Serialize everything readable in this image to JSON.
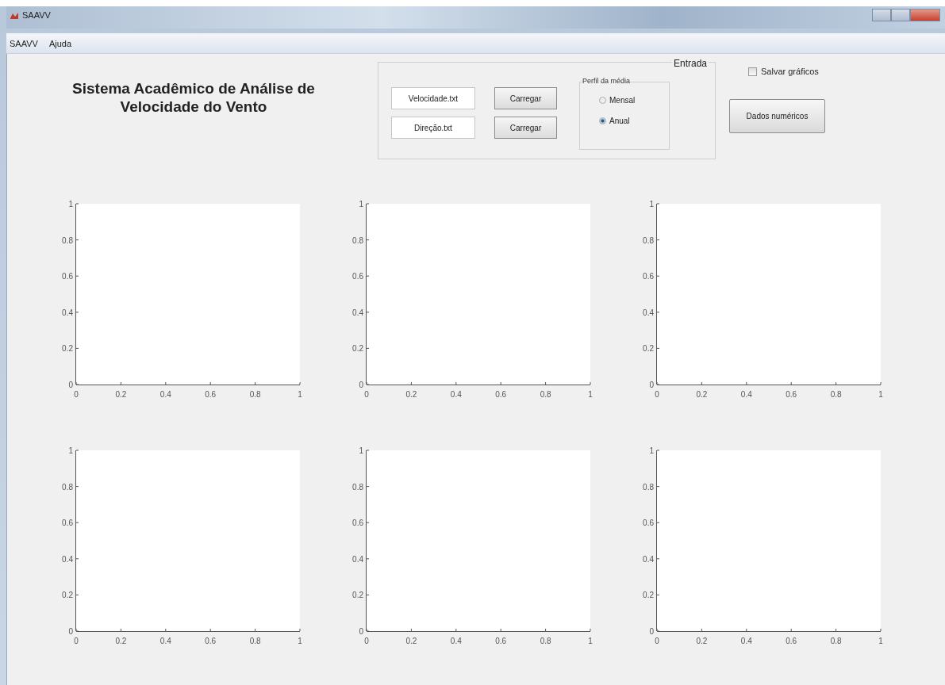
{
  "window": {
    "title": "SAAVV"
  },
  "menu": [
    {
      "label": "SAAVV"
    },
    {
      "label": "Ajuda"
    }
  ],
  "heading": "Sistema Acadêmico de Análise de Velocidade do Vento",
  "input_panel": {
    "title": "Entrada",
    "files": [
      {
        "value": "Velocidade.txt",
        "button": "Carregar"
      },
      {
        "value": "Direção.txt",
        "button": "Carregar"
      }
    ],
    "profile": {
      "title": "Perfil da média",
      "options": [
        {
          "label": "Mensal",
          "selected": false
        },
        {
          "label": "Anual",
          "selected": true
        }
      ]
    }
  },
  "save_charts": {
    "label": "Salvar gráficos",
    "checked": false
  },
  "numeric_button": "Dados numéricos",
  "plots": [
    {
      "chart_data": {
        "type": "line",
        "xlim": [
          0,
          1
        ],
        "ylim": [
          0,
          1
        ],
        "xticks": [
          0,
          0.2,
          0.4,
          0.6,
          0.8,
          1
        ],
        "yticks": [
          0,
          0.2,
          0.4,
          0.6,
          0.8,
          1
        ]
      }
    },
    {
      "chart_data": {
        "type": "line",
        "xlim": [
          0,
          1
        ],
        "ylim": [
          0,
          1
        ],
        "xticks": [
          0,
          0.2,
          0.4,
          0.6,
          0.8,
          1
        ],
        "yticks": [
          0,
          0.2,
          0.4,
          0.6,
          0.8,
          1
        ]
      }
    },
    {
      "chart_data": {
        "type": "line",
        "xlim": [
          0,
          1
        ],
        "ylim": [
          0,
          1
        ],
        "xticks": [
          0,
          0.2,
          0.4,
          0.6,
          0.8,
          1
        ],
        "yticks": [
          0,
          0.2,
          0.4,
          0.6,
          0.8,
          1
        ]
      }
    },
    {
      "chart_data": {
        "type": "line",
        "xlim": [
          0,
          1
        ],
        "ylim": [
          0,
          1
        ],
        "xticks": [
          0,
          0.2,
          0.4,
          0.6,
          0.8,
          1
        ],
        "yticks": [
          0,
          0.2,
          0.4,
          0.6,
          0.8,
          1
        ]
      }
    },
    {
      "chart_data": {
        "type": "line",
        "xlim": [
          0,
          1
        ],
        "ylim": [
          0,
          1
        ],
        "xticks": [
          0,
          0.2,
          0.4,
          0.6,
          0.8,
          1
        ],
        "yticks": [
          0,
          0.2,
          0.4,
          0.6,
          0.8,
          1
        ]
      }
    },
    {
      "chart_data": {
        "type": "line",
        "xlim": [
          0,
          1
        ],
        "ylim": [
          0,
          1
        ],
        "xticks": [
          0,
          0.2,
          0.4,
          0.6,
          0.8,
          1
        ],
        "yticks": [
          0,
          0.2,
          0.4,
          0.6,
          0.8,
          1
        ]
      }
    }
  ]
}
